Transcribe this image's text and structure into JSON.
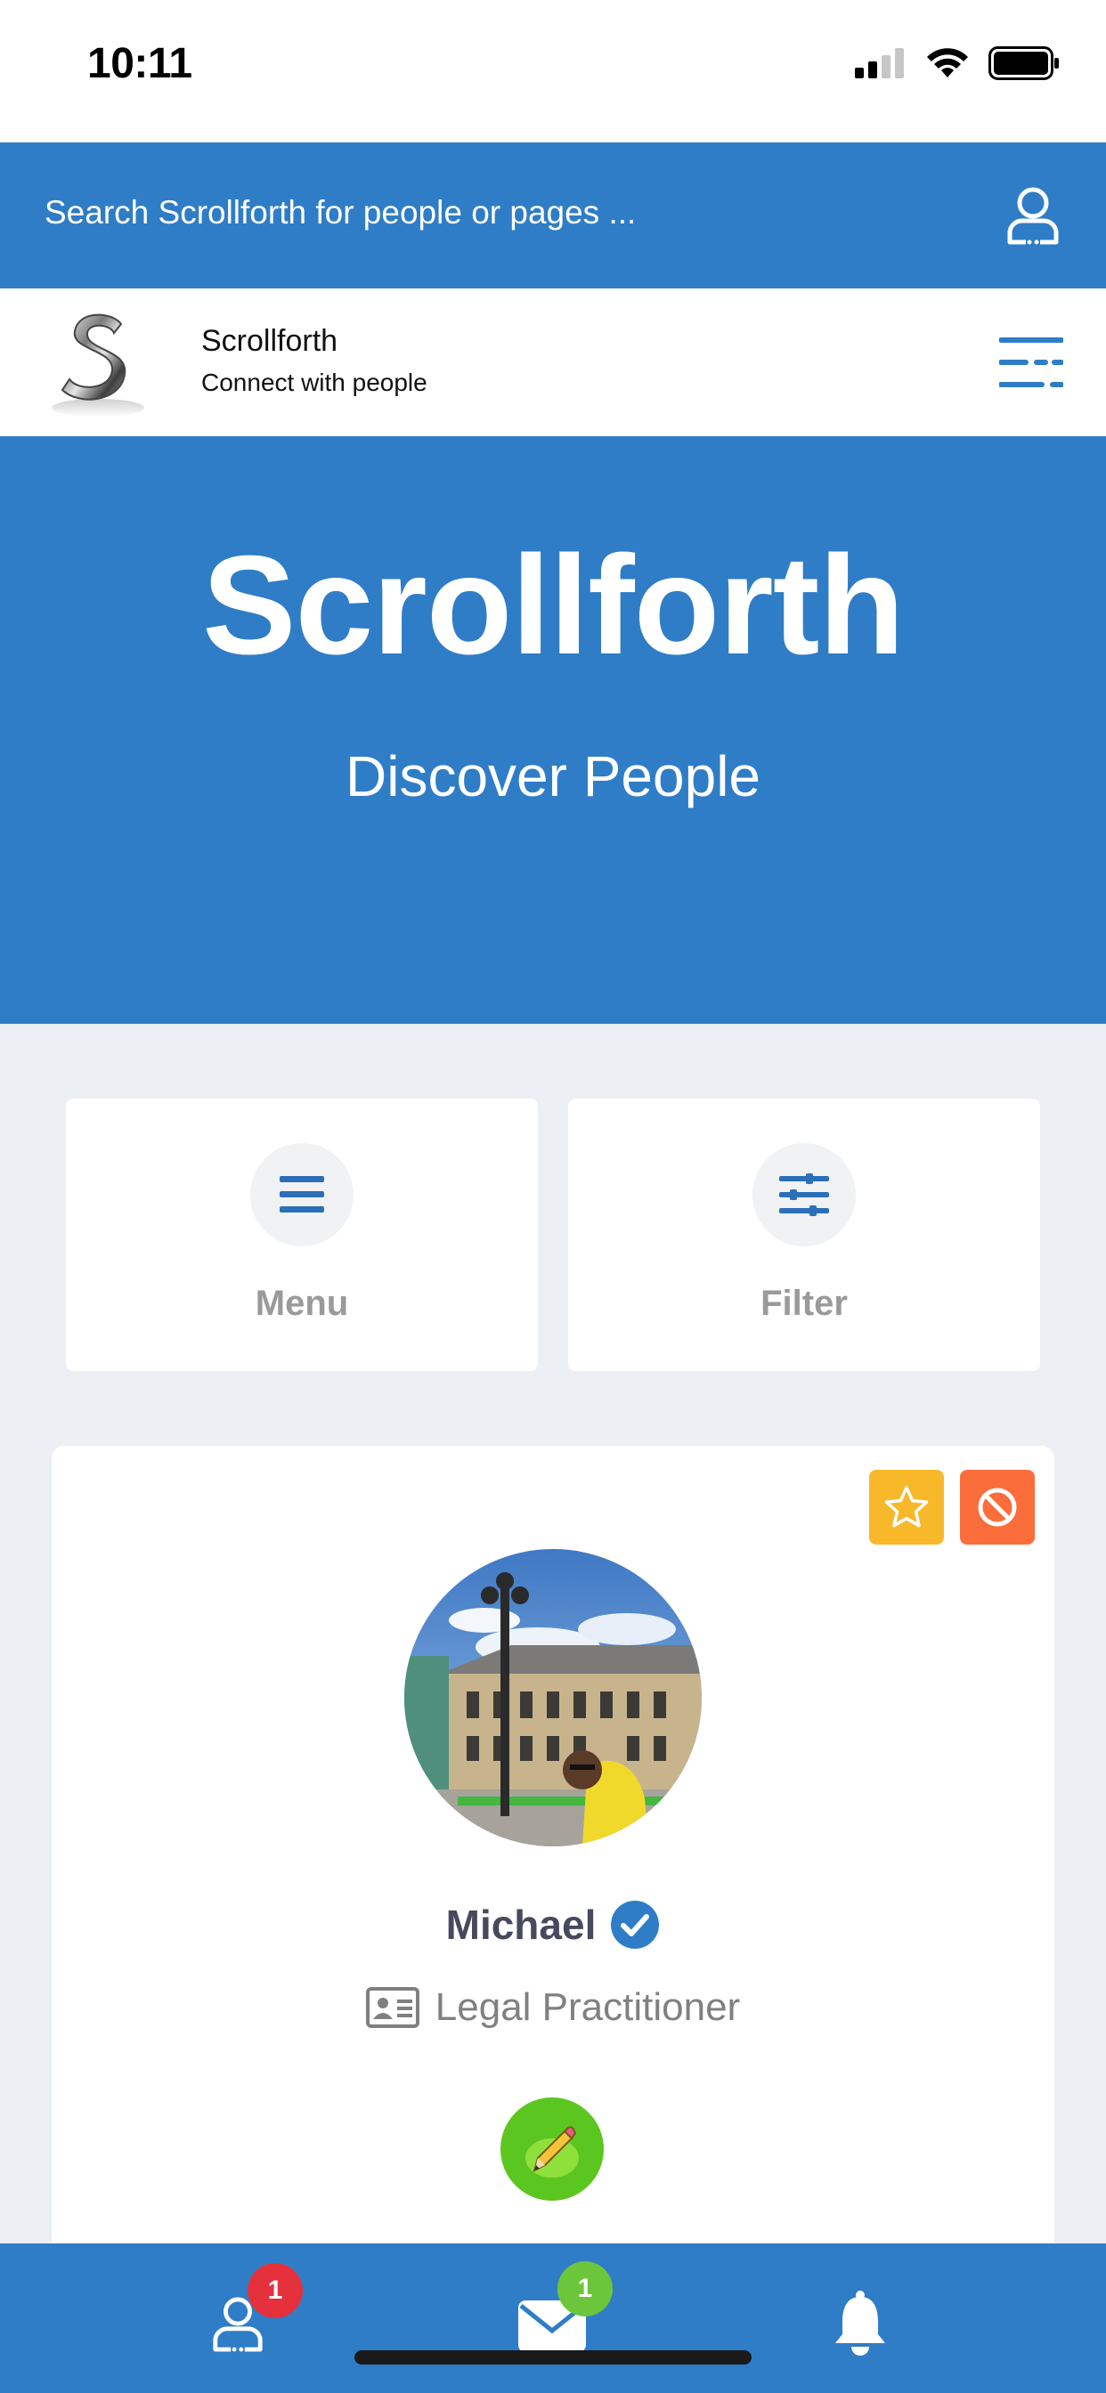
{
  "status_bar": {
    "time": "10:11",
    "icons": [
      "cellular-signal-icon",
      "wifi-icon",
      "battery-icon"
    ]
  },
  "search": {
    "placeholder": "Search Scrollforth for people or pages ...",
    "account_icon": "user-icon"
  },
  "brand": {
    "name": "Scrollforth",
    "tagline": "Connect with people",
    "logo_icon": "scrollforth-logo",
    "menu_icon": "menu-lines-icon"
  },
  "hero": {
    "title": "Scrollforth",
    "subtitle": "Discover People"
  },
  "tiles": {
    "menu_label": "Menu",
    "filter_label": "Filter"
  },
  "profile_card": {
    "name": "Michael",
    "profession": "Legal Practitioner",
    "verified": true,
    "actions": [
      "star-icon",
      "block-icon",
      "pencil-icon"
    ]
  },
  "bottom_nav": {
    "profile_badge": "1",
    "messages_badge": "1",
    "icons": [
      "user-icon",
      "envelope-icon",
      "bell-icon"
    ]
  },
  "colors": {
    "primary": "#2f7dc6",
    "background": "#eceff3",
    "star_button": "#f7b82a",
    "block_button": "#fb6e3b",
    "edit_button": "#5cc621",
    "badge_red": "#e5313b",
    "badge_green": "#6cc63c",
    "verified_badge": "#2f7dc6"
  }
}
